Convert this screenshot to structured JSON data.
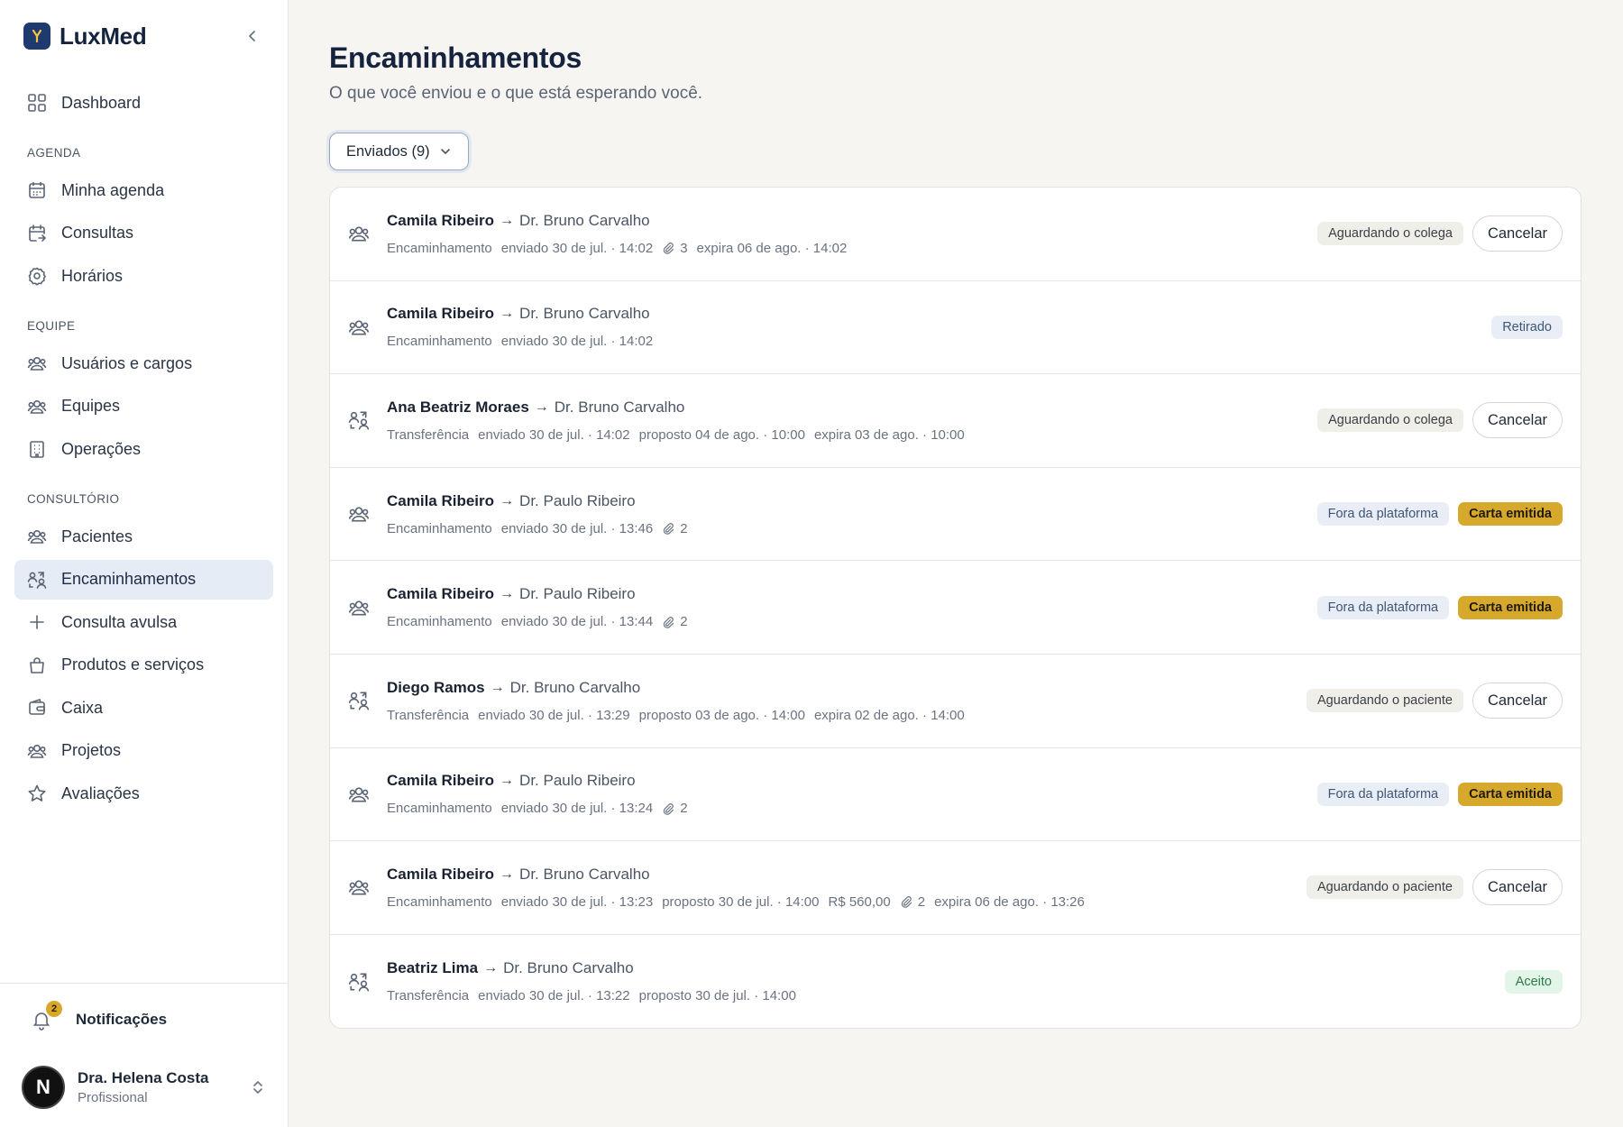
{
  "brand": {
    "name": "LuxMed"
  },
  "sidebar": {
    "dashboard": "Dashboard",
    "sections": {
      "agenda": "AGENDA",
      "equipe": "EQUIPE",
      "consultorio": "CONSULTÓRIO"
    },
    "items": {
      "minha_agenda": "Minha agenda",
      "consultas": "Consultas",
      "horarios": "Horários",
      "usuarios": "Usuários e cargos",
      "equipes": "Equipes",
      "operacoes": "Operações",
      "pacientes": "Pacientes",
      "encaminhamentos": "Encaminhamentos",
      "consulta_avulsa": "Consulta avulsa",
      "produtos": "Produtos e serviços",
      "caixa": "Caixa",
      "projetos": "Projetos",
      "avaliacoes": "Avaliações"
    },
    "notifications": {
      "label": "Notificações",
      "count": "2"
    },
    "user": {
      "initial": "N",
      "name": "Dra. Helena Costa",
      "role": "Profissional"
    }
  },
  "main": {
    "title": "Encaminhamentos",
    "subtitle": "O que você enviou e o que está esperando você.",
    "filter": "Enviados (9)",
    "cancel_label": "Cancelar",
    "rows": [
      {
        "icon": "users",
        "from": "Camila Ribeiro",
        "to": "Dr. Bruno Carvalho",
        "type": "Encaminhamento",
        "sent": "enviado 30 de jul. · 14:02",
        "proposed": "",
        "price": "",
        "attachments": "3",
        "expires": "expira 06 de ago. · 14:02",
        "status": "Aguardando o colega",
        "status2": "",
        "cancel": true
      },
      {
        "icon": "users",
        "from": "Camila Ribeiro",
        "to": "Dr. Bruno Carvalho",
        "type": "Encaminhamento",
        "sent": "enviado 30 de jul. · 14:02",
        "proposed": "",
        "price": "",
        "attachments": "",
        "expires": "",
        "status": "",
        "status2": "Retirado",
        "cancel": false
      },
      {
        "icon": "transfer",
        "from": "Ana Beatriz Moraes",
        "to": "Dr. Bruno Carvalho",
        "type": "Transferência",
        "sent": "enviado 30 de jul. · 14:02",
        "proposed": "proposto 04 de ago. · 10:00",
        "price": "",
        "attachments": "",
        "expires": "expira 03 de ago. · 10:00",
        "status": "Aguardando o colega",
        "status2": "",
        "cancel": true
      },
      {
        "icon": "users",
        "from": "Camila Ribeiro",
        "to": "Dr. Paulo Ribeiro",
        "type": "Encaminhamento",
        "sent": "enviado 30 de jul. · 13:46",
        "proposed": "",
        "price": "",
        "attachments": "2",
        "expires": "",
        "status": "Fora da plataforma",
        "status2": "Carta emitida",
        "cancel": false
      },
      {
        "icon": "users",
        "from": "Camila Ribeiro",
        "to": "Dr. Paulo Ribeiro",
        "type": "Encaminhamento",
        "sent": "enviado 30 de jul. · 13:44",
        "proposed": "",
        "price": "",
        "attachments": "2",
        "expires": "",
        "status": "Fora da plataforma",
        "status2": "Carta emitida",
        "cancel": false
      },
      {
        "icon": "transfer",
        "from": "Diego Ramos",
        "to": "Dr. Bruno Carvalho",
        "type": "Transferência",
        "sent": "enviado 30 de jul. · 13:29",
        "proposed": "proposto 03 de ago. · 14:00",
        "price": "",
        "attachments": "",
        "expires": "expira 02 de ago. · 14:00",
        "status": "Aguardando o paciente",
        "status2": "",
        "cancel": true
      },
      {
        "icon": "users",
        "from": "Camila Ribeiro",
        "to": "Dr. Paulo Ribeiro",
        "type": "Encaminhamento",
        "sent": "enviado 30 de jul. · 13:24",
        "proposed": "",
        "price": "",
        "attachments": "2",
        "expires": "",
        "status": "Fora da plataforma",
        "status2": "Carta emitida",
        "cancel": false
      },
      {
        "icon": "users",
        "from": "Camila Ribeiro",
        "to": "Dr. Bruno Carvalho",
        "type": "Encaminhamento",
        "sent": "enviado 30 de jul. · 13:23",
        "proposed": "proposto 30 de jul. · 14:00",
        "price": "R$ 560,00",
        "attachments": "2",
        "expires": "expira 06 de ago. · 13:26",
        "status": "Aguardando o paciente",
        "status2": "",
        "cancel": true
      },
      {
        "icon": "transfer",
        "from": "Beatriz Lima",
        "to": "Dr. Bruno Carvalho",
        "type": "Transferência",
        "sent": "enviado 30 de jul. · 13:22",
        "proposed": "proposto 30 de jul. · 14:00",
        "price": "",
        "attachments": "",
        "expires": "",
        "status": "",
        "status2": "Aceito",
        "cancel": false
      }
    ]
  },
  "colors": {
    "accent": "#1e3a6e",
    "gold": "#d6a82b",
    "green": "#2f7a48",
    "background": "#f6f5f1"
  }
}
